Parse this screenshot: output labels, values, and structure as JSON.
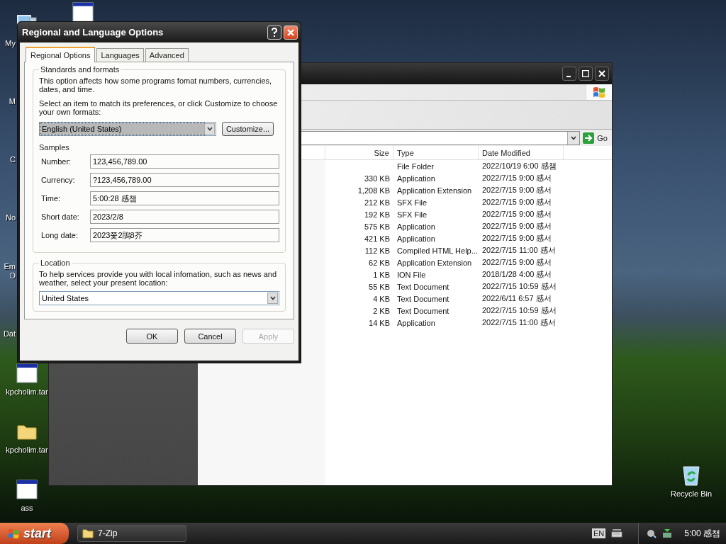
{
  "desktop_icons": [
    {
      "label": "My",
      "kind": "computer",
      "covered": true
    },
    {
      "label": "M",
      "kind": "none",
      "covered": true
    },
    {
      "label": "C",
      "kind": "none",
      "covered": true
    },
    {
      "label": "No",
      "kind": "none",
      "covered": true
    },
    {
      "label": "Em D",
      "kind": "none",
      "covered": true
    },
    {
      "label": "Dat",
      "kind": "none",
      "covered": true
    },
    {
      "label": "kpcholim.tar",
      "kind": "window",
      "covered": false
    },
    {
      "label": "kpcholim.tar",
      "kind": "folder",
      "covered": false
    },
    {
      "label": "ass",
      "kind": "window",
      "covered": false
    }
  ],
  "desktop_icon_top": {
    "kind": "window"
  },
  "recycle_bin": {
    "label": "Recycle Bin"
  },
  "explorer": {
    "columns": [
      "Size",
      "Type",
      "Date Modified"
    ],
    "go_label": "Go",
    "rows": [
      {
        "size": "",
        "type": "File Folder",
        "date": "2022/10/19 6:00 感챔"
      },
      {
        "size": "330 KB",
        "type": "Application",
        "date": "2022/7/15 9:00 感서"
      },
      {
        "size": "1,208 KB",
        "type": "Application Extension",
        "date": "2022/7/15 9:00 感서"
      },
      {
        "size": "212 KB",
        "type": "SFX File",
        "date": "2022/7/15 9:00 感서"
      },
      {
        "size": "192 KB",
        "type": "SFX File",
        "date": "2022/7/15 9:00 感서"
      },
      {
        "size": "575 KB",
        "type": "Application",
        "date": "2022/7/15 9:00 感서"
      },
      {
        "size": "421 KB",
        "type": "Application",
        "date": "2022/7/15 9:00 感서"
      },
      {
        "size": "112 KB",
        "type": "Compiled HTML Help...",
        "date": "2022/7/15 11:00 感서"
      },
      {
        "size": "62 KB",
        "type": "Application Extension",
        "date": "2022/7/15 9:00 感서"
      },
      {
        "size": "1 KB",
        "type": "ION File",
        "date": "2018/1/28 4:00 感서"
      },
      {
        "size": "55 KB",
        "type": "Text Document",
        "date": "2022/7/15 10:59 感서"
      },
      {
        "size": "4 KB",
        "type": "Text Document",
        "date": "2022/6/11 6:57 感서"
      },
      {
        "size": "2 KB",
        "type": "Text Document",
        "date": "2022/7/15 10:59 感서"
      },
      {
        "size": "14 KB",
        "type": "Application",
        "date": "2022/7/15 11:00 感서"
      }
    ]
  },
  "dialog": {
    "title": "Regional and Language Options",
    "tabs": [
      {
        "label": "Regional Options",
        "selected": true
      },
      {
        "label": "Languages",
        "selected": false
      },
      {
        "label": "Advanced",
        "selected": false
      }
    ],
    "standards": {
      "legend": "Standards and formats",
      "description": "This option affects how some programs fomat numbers, currencies, dates, and time.",
      "prompt": "Select an item to match its preferences, or click Customize to choose your own formats:",
      "format_value": "English (United States)",
      "customize_label": "Customize..."
    },
    "samples": {
      "legend": "Samples",
      "rows": [
        {
          "label": "Number:",
          "value": "123,456,789.00"
        },
        {
          "label": "Currency:",
          "value": "?123,456,789.00"
        },
        {
          "label": "Time:",
          "value": "5:00:28 感챔"
        },
        {
          "label": "Short date:",
          "value": "2023/2/8"
        },
        {
          "label": "Long date:",
          "value": "2023쫓2鵑8芥"
        }
      ]
    },
    "location": {
      "legend": "Location",
      "description": "To help services provide you with local infomation, such as news and weather, select your present location:",
      "value": "United States"
    },
    "buttons": [
      {
        "label": "OK",
        "disabled": false
      },
      {
        "label": "Cancel",
        "disabled": false
      },
      {
        "label": "Apply",
        "disabled": true
      }
    ]
  },
  "taskbar": {
    "start_label": "start",
    "tasks": [
      {
        "label": "7-Zip"
      }
    ],
    "language": "EN",
    "clock": "5:00 感챔"
  }
}
